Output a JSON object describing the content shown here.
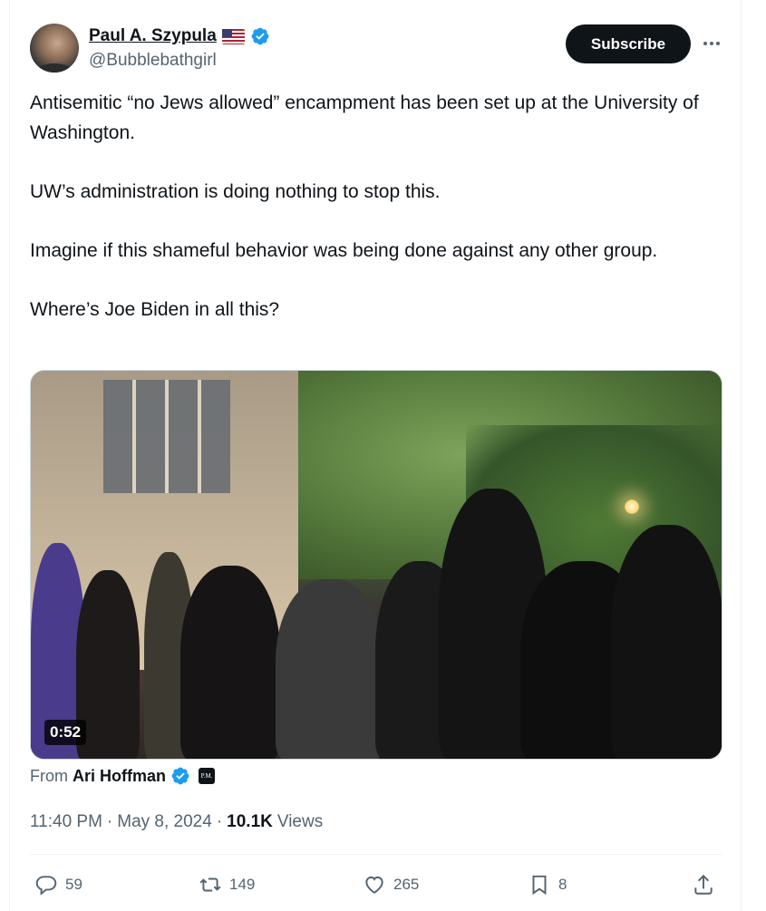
{
  "author": {
    "display_name": "Paul A. Szypula",
    "handle": "@Bubblebathgirl",
    "flag_icon": "us-flag-icon",
    "verified_icon": "verified-badge-icon"
  },
  "header": {
    "subscribe_label": "Subscribe",
    "more_icon": "more-horizontal-icon"
  },
  "tweet": {
    "paragraphs": [
      "Antisemitic “no Jews allowed” encampment has been set up at the University of Washington.",
      "UW’s administration is doing nothing to stop this.",
      "Imagine if this shameful behavior was being done against any other group.",
      "Where’s Joe Biden in all this?"
    ]
  },
  "media": {
    "type": "video",
    "duration": "0:52"
  },
  "attribution": {
    "from_label": "From",
    "from_name": "Ari Hoffman",
    "verified_icon": "verified-badge-icon",
    "affiliate_badge_text": "P.M."
  },
  "meta": {
    "time": "11:40 PM",
    "separator": "·",
    "date": "May 8, 2024",
    "views_count": "10.1K",
    "views_label": "Views"
  },
  "actions": {
    "replies": "59",
    "reposts": "149",
    "likes": "265",
    "bookmarks": "8"
  },
  "colors": {
    "accent_blue": "#1d9bf0",
    "text_primary": "#0f1419",
    "text_secondary": "#536471",
    "border": "#eff3f4"
  }
}
